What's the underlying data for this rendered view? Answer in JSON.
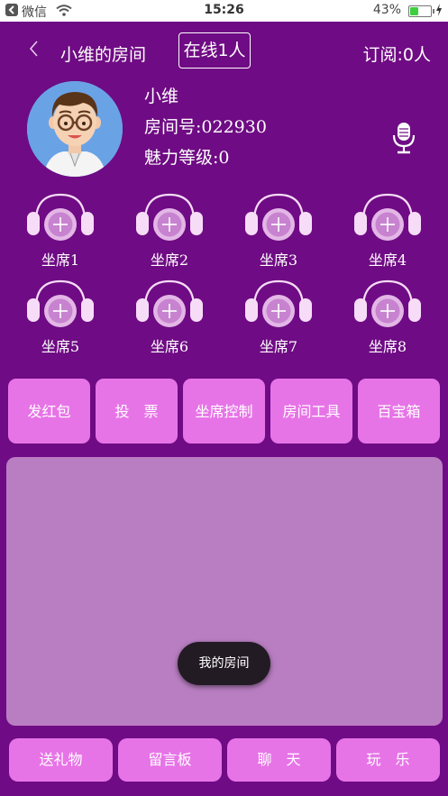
{
  "status_bar": {
    "carrier": "微信",
    "time": "15:26",
    "battery_percent": "43%",
    "battery_level": 0.43
  },
  "nav": {
    "title": "小维的房间",
    "online": "在线1人",
    "subscribe": "订阅:0人"
  },
  "profile": {
    "name": "小维",
    "room_id": "房间号:022930",
    "charm_level": "魅力等级:0"
  },
  "seats": [
    {
      "label": "坐席1"
    },
    {
      "label": "坐席2"
    },
    {
      "label": "坐席3"
    },
    {
      "label": "坐席4"
    },
    {
      "label": "坐席5"
    },
    {
      "label": "坐席6"
    },
    {
      "label": "坐席7"
    },
    {
      "label": "坐席8"
    }
  ],
  "functions": [
    {
      "label": "发红包"
    },
    {
      "label": "投　票"
    },
    {
      "label": "坐席控制"
    },
    {
      "label": "房间工具"
    },
    {
      "label": "百宝箱"
    }
  ],
  "toast": "我的房间",
  "bottom_bar": [
    {
      "label": "送礼物"
    },
    {
      "label": "留言板"
    },
    {
      "label": "聊　天"
    },
    {
      "label": "玩　乐"
    }
  ],
  "colors": {
    "background": "#6f0b84",
    "button": "#e774e7",
    "panel": "#b97ec2"
  }
}
